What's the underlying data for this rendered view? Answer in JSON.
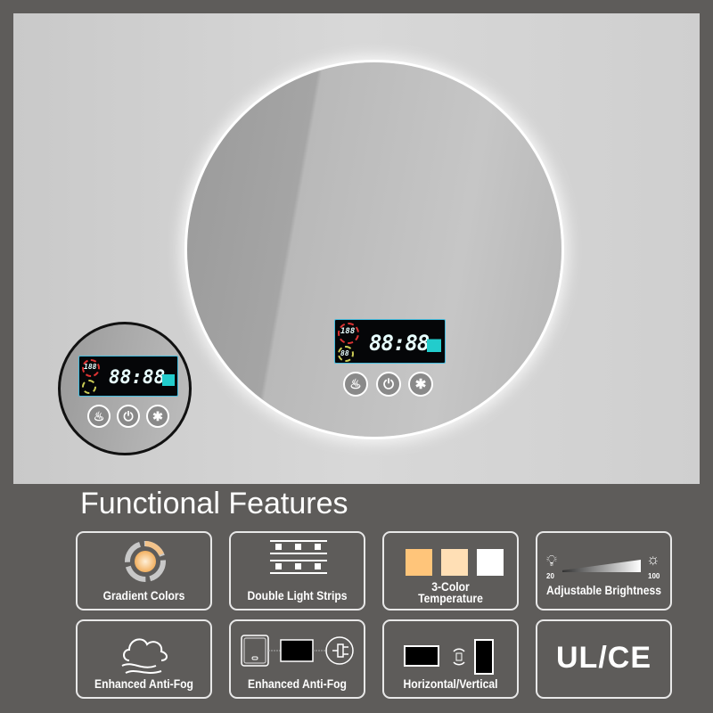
{
  "display": {
    "clock": "88:88",
    "small_top": "188",
    "small_bottom": "88"
  },
  "buttons": [
    {
      "name": "anti-fog",
      "icon": "steam-icon",
      "glyph": "♨"
    },
    {
      "name": "power",
      "icon": "power-icon",
      "glyph": "⏻"
    },
    {
      "name": "bluetooth",
      "icon": "bluetooth-icon",
      "glyph": "✱"
    }
  ],
  "title": "Functional Features",
  "features": [
    {
      "label": "Gradient Colors",
      "icon": "gradient-cycle-icon"
    },
    {
      "label": "Double Light Strips",
      "icon": "light-strips-icon"
    },
    {
      "label_line1": "3-Color",
      "label_line2": "Temperature",
      "icon": "color-swatches-icon",
      "colors": [
        "#ffc57a",
        "#ffdfb5",
        "#ffffff"
      ]
    },
    {
      "label": "Adjustable Brightness",
      "icon": "brightness-icon",
      "min": "20",
      "max": "100"
    },
    {
      "label": "Enhanced Anti-Fog",
      "icon": "cloud-fog-icon"
    },
    {
      "label": "Enhanced Anti-Fog",
      "icon": "switch-plug-icon"
    },
    {
      "label": "Horizontal/Vertical",
      "icon": "rotate-icon"
    },
    {
      "label": "",
      "icon": "ul-ce-icon",
      "marks": "UL/CE"
    }
  ]
}
